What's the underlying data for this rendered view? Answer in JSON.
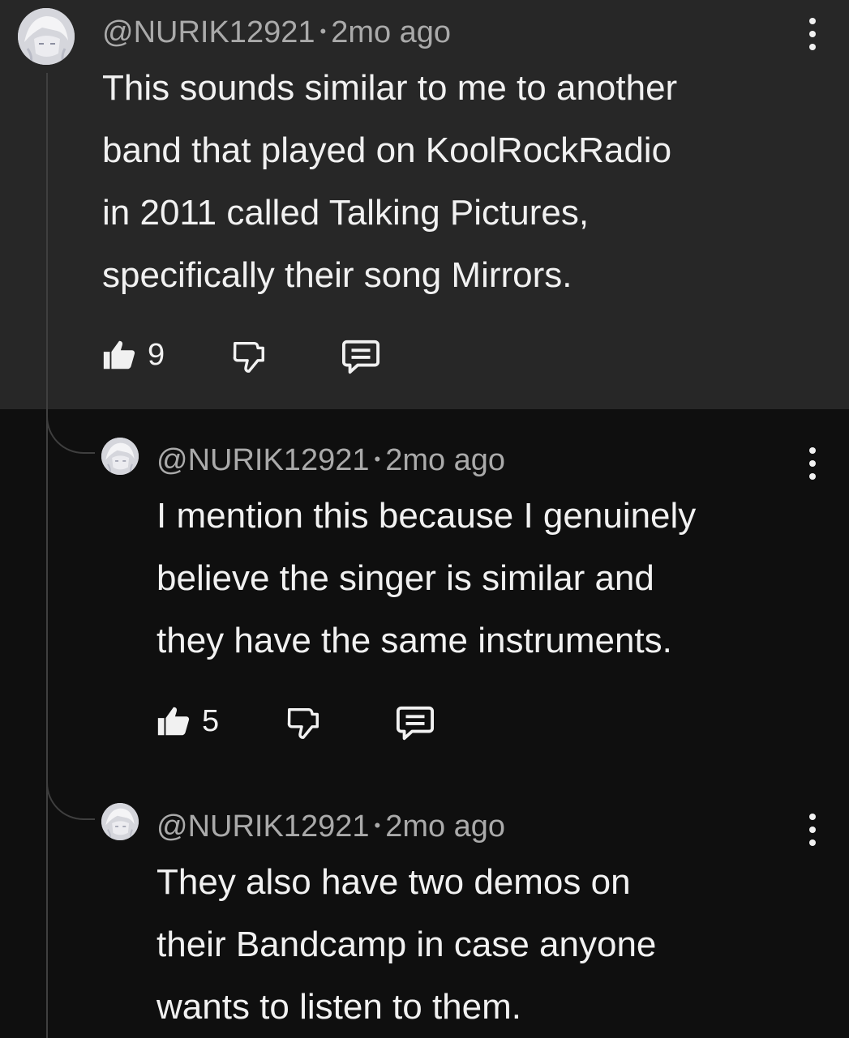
{
  "comments": [
    {
      "username": "@NURIK12921",
      "time": "2mo ago",
      "lines": [
        "This sounds similar to me to another",
        "band that played on KoolRockRadio",
        "in 2011 called Talking Pictures,",
        "specifically their song Mirrors."
      ],
      "likes": "9"
    },
    {
      "username": "@NURIK12921",
      "time": "2mo ago",
      "lines": [
        "I mention this because I genuinely",
        "believe the singer is similar and",
        "they have the same instruments."
      ],
      "likes": "5"
    },
    {
      "username": "@NURIK12921",
      "time": "2mo ago",
      "lines": [
        "They also have two demos on",
        "their Bandcamp in case anyone",
        "wants to listen to them."
      ]
    }
  ],
  "separator": "•",
  "colors": {
    "background": "#0f0f0f",
    "highlight": "#272727",
    "text": "#f1f1f1",
    "meta": "#aaaaaa",
    "thread_line": "#3f3f3f"
  },
  "icons": [
    "avatar-image",
    "thumbs-up-icon",
    "thumbs-down-icon",
    "reply-icon",
    "more-vert-icon"
  ]
}
